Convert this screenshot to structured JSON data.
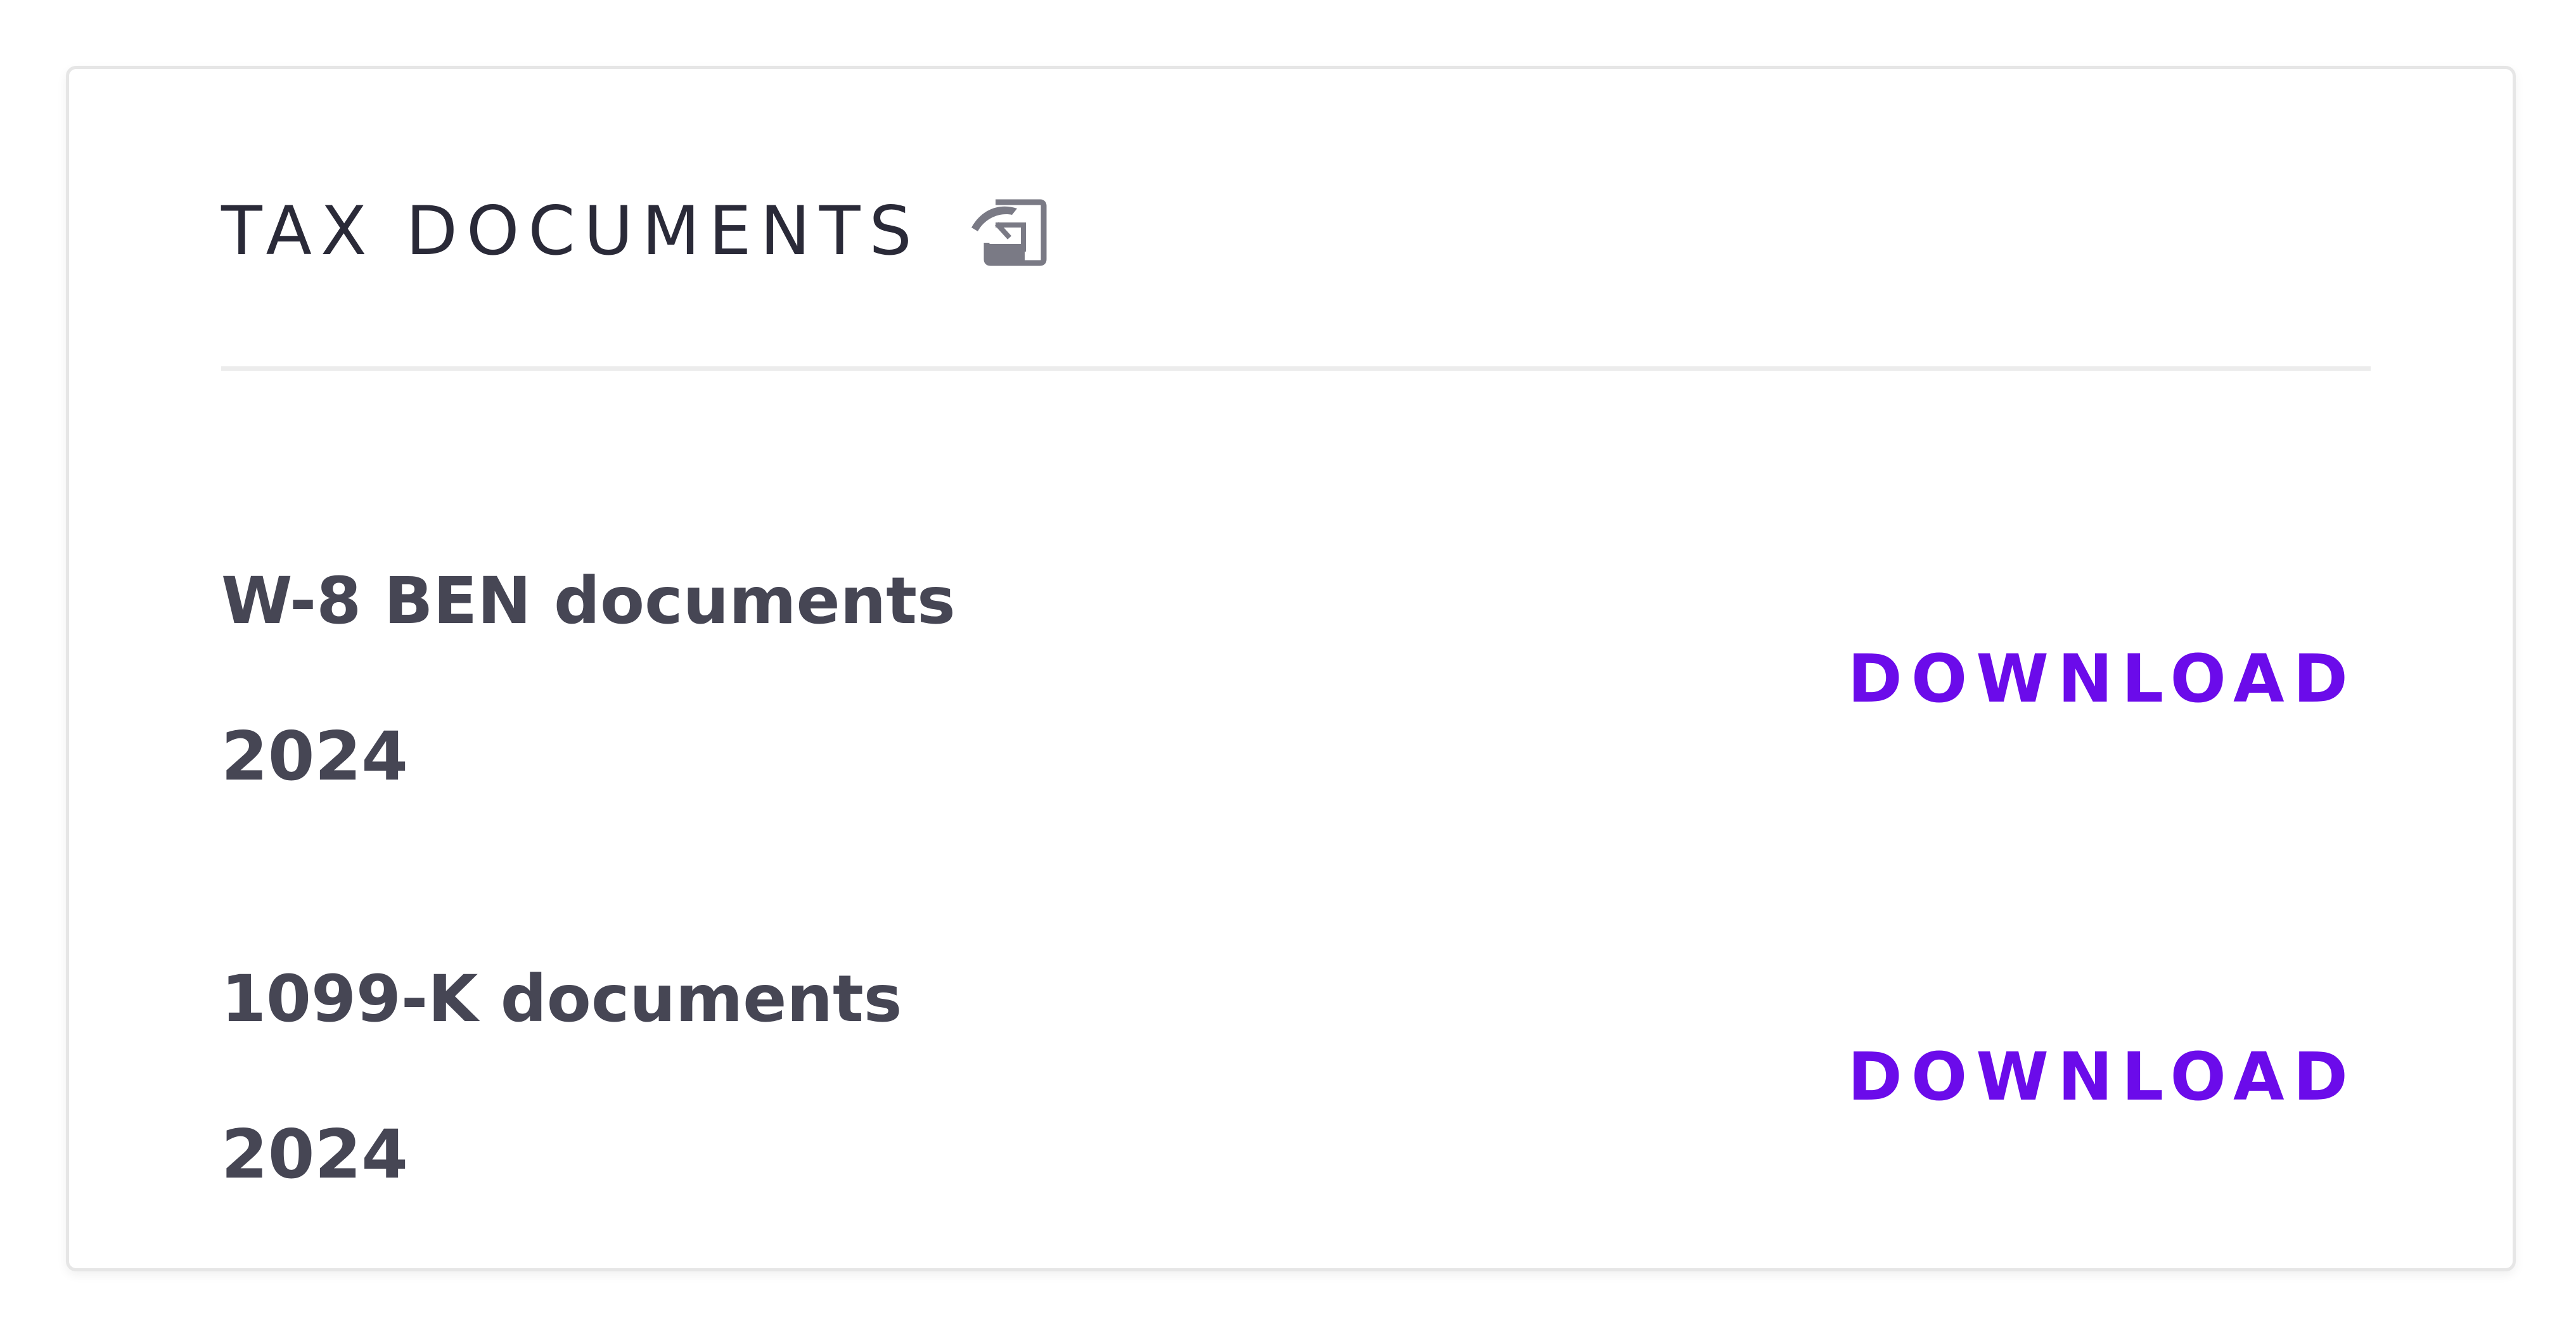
{
  "card": {
    "title": "TAX DOCUMENTS",
    "title_icon": "signed-document-icon"
  },
  "documents": [
    {
      "name": "W-8 BEN documents",
      "year": "2024",
      "action_label": "DOWNLOAD"
    },
    {
      "name": "1099-K documents",
      "year": "2024",
      "action_label": "DOWNLOAD"
    }
  ],
  "colors": {
    "accent": "#6b0bea",
    "title_text": "#2a2a38",
    "body_text": "#464654",
    "icon": "#7a7a85"
  }
}
